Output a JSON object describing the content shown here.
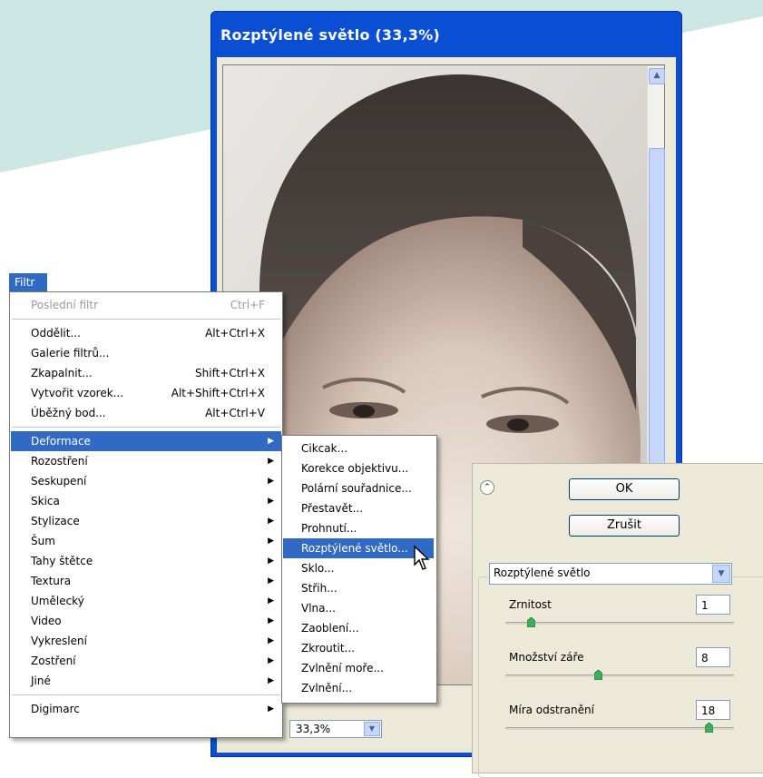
{
  "preview_window": {
    "title": "Rozptýlené světlo (33,3%)",
    "zoom": "33,3%"
  },
  "menu": {
    "title": "Filtr",
    "items": [
      {
        "label": "Poslední filtr",
        "shortcut": "Ctrl+F",
        "disabled": true
      },
      {
        "label": "Oddělit...",
        "shortcut": "Alt+Ctrl+X"
      },
      {
        "label": "Galerie filtrů...",
        "shortcut": ""
      },
      {
        "label": "Zkapalnit...",
        "shortcut": "Shift+Ctrl+X"
      },
      {
        "label": "Vytvořit vzorek...",
        "shortcut": "Alt+Shift+Ctrl+X"
      },
      {
        "label": "Úběžný bod...",
        "shortcut": "Alt+Ctrl+V"
      },
      {
        "label": "Deformace",
        "selected": true,
        "submenu": true
      },
      {
        "label": "Rozostření",
        "submenu": true
      },
      {
        "label": "Seskupení",
        "submenu": true
      },
      {
        "label": "Skica",
        "submenu": true
      },
      {
        "label": "Stylizace",
        "submenu": true
      },
      {
        "label": "Šum",
        "submenu": true
      },
      {
        "label": "Tahy štětce",
        "submenu": true
      },
      {
        "label": "Textura",
        "submenu": true
      },
      {
        "label": "Umělecký",
        "submenu": true
      },
      {
        "label": "Video",
        "submenu": true
      },
      {
        "label": "Vykreslení",
        "submenu": true
      },
      {
        "label": "Zostření",
        "submenu": true
      },
      {
        "label": "Jiné",
        "submenu": true
      },
      {
        "label": "Digimarc",
        "submenu": true
      }
    ]
  },
  "submenu": {
    "items": [
      "Cikcak...",
      "Korekce objektivu...",
      "Polární souřadnice...",
      "Přestavět...",
      "Prohnutí...",
      "Rozptýlené světlo...",
      "Sklo...",
      "Střih...",
      "Vlna...",
      "Zaoblení...",
      "Zkroutit...",
      "Zvlnění moře...",
      "Zvlnění..."
    ],
    "selected_index": 5
  },
  "dialog": {
    "ok_label": "OK",
    "cancel_label": "Zrušit",
    "filter_select": "Rozptýlené světlo",
    "params": [
      {
        "label": "Zrnitost",
        "value": "1",
        "slider_fraction": 0.1
      },
      {
        "label": "Množství záře",
        "value": "8",
        "slider_fraction": 0.4
      },
      {
        "label": "Míra odstranění",
        "value": "18",
        "slider_fraction": 0.9
      }
    ]
  },
  "colors": {
    "title_bar": "#0a4ed4",
    "menu_highlight": "#316ac5",
    "background_shape": "#cce6e3",
    "dialog_bg": "#ece9d8"
  }
}
